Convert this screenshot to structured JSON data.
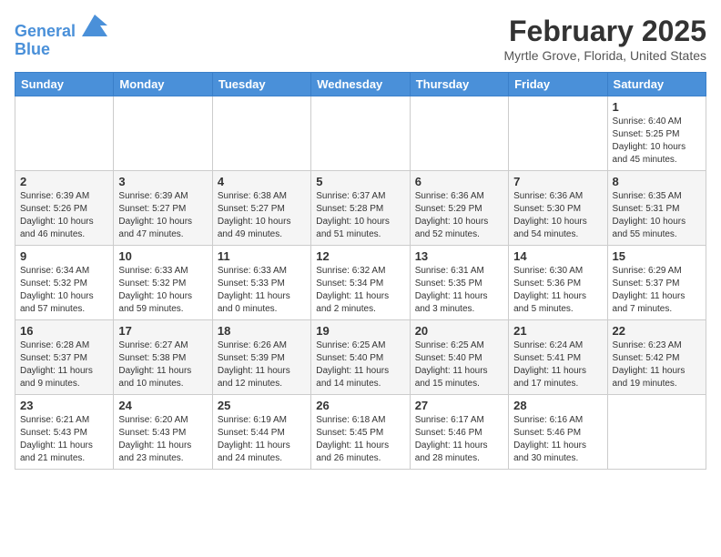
{
  "header": {
    "logo_line1": "General",
    "logo_line2": "Blue",
    "month_title": "February 2025",
    "location": "Myrtle Grove, Florida, United States"
  },
  "weekdays": [
    "Sunday",
    "Monday",
    "Tuesday",
    "Wednesday",
    "Thursday",
    "Friday",
    "Saturday"
  ],
  "weeks": [
    [
      {
        "day": "",
        "info": ""
      },
      {
        "day": "",
        "info": ""
      },
      {
        "day": "",
        "info": ""
      },
      {
        "day": "",
        "info": ""
      },
      {
        "day": "",
        "info": ""
      },
      {
        "day": "",
        "info": ""
      },
      {
        "day": "1",
        "info": "Sunrise: 6:40 AM\nSunset: 5:25 PM\nDaylight: 10 hours and 45 minutes."
      }
    ],
    [
      {
        "day": "2",
        "info": "Sunrise: 6:39 AM\nSunset: 5:26 PM\nDaylight: 10 hours and 46 minutes."
      },
      {
        "day": "3",
        "info": "Sunrise: 6:39 AM\nSunset: 5:27 PM\nDaylight: 10 hours and 47 minutes."
      },
      {
        "day": "4",
        "info": "Sunrise: 6:38 AM\nSunset: 5:27 PM\nDaylight: 10 hours and 49 minutes."
      },
      {
        "day": "5",
        "info": "Sunrise: 6:37 AM\nSunset: 5:28 PM\nDaylight: 10 hours and 51 minutes."
      },
      {
        "day": "6",
        "info": "Sunrise: 6:36 AM\nSunset: 5:29 PM\nDaylight: 10 hours and 52 minutes."
      },
      {
        "day": "7",
        "info": "Sunrise: 6:36 AM\nSunset: 5:30 PM\nDaylight: 10 hours and 54 minutes."
      },
      {
        "day": "8",
        "info": "Sunrise: 6:35 AM\nSunset: 5:31 PM\nDaylight: 10 hours and 55 minutes."
      }
    ],
    [
      {
        "day": "9",
        "info": "Sunrise: 6:34 AM\nSunset: 5:32 PM\nDaylight: 10 hours and 57 minutes."
      },
      {
        "day": "10",
        "info": "Sunrise: 6:33 AM\nSunset: 5:32 PM\nDaylight: 10 hours and 59 minutes."
      },
      {
        "day": "11",
        "info": "Sunrise: 6:33 AM\nSunset: 5:33 PM\nDaylight: 11 hours and 0 minutes."
      },
      {
        "day": "12",
        "info": "Sunrise: 6:32 AM\nSunset: 5:34 PM\nDaylight: 11 hours and 2 minutes."
      },
      {
        "day": "13",
        "info": "Sunrise: 6:31 AM\nSunset: 5:35 PM\nDaylight: 11 hours and 3 minutes."
      },
      {
        "day": "14",
        "info": "Sunrise: 6:30 AM\nSunset: 5:36 PM\nDaylight: 11 hours and 5 minutes."
      },
      {
        "day": "15",
        "info": "Sunrise: 6:29 AM\nSunset: 5:37 PM\nDaylight: 11 hours and 7 minutes."
      }
    ],
    [
      {
        "day": "16",
        "info": "Sunrise: 6:28 AM\nSunset: 5:37 PM\nDaylight: 11 hours and 9 minutes."
      },
      {
        "day": "17",
        "info": "Sunrise: 6:27 AM\nSunset: 5:38 PM\nDaylight: 11 hours and 10 minutes."
      },
      {
        "day": "18",
        "info": "Sunrise: 6:26 AM\nSunset: 5:39 PM\nDaylight: 11 hours and 12 minutes."
      },
      {
        "day": "19",
        "info": "Sunrise: 6:25 AM\nSunset: 5:40 PM\nDaylight: 11 hours and 14 minutes."
      },
      {
        "day": "20",
        "info": "Sunrise: 6:25 AM\nSunset: 5:40 PM\nDaylight: 11 hours and 15 minutes."
      },
      {
        "day": "21",
        "info": "Sunrise: 6:24 AM\nSunset: 5:41 PM\nDaylight: 11 hours and 17 minutes."
      },
      {
        "day": "22",
        "info": "Sunrise: 6:23 AM\nSunset: 5:42 PM\nDaylight: 11 hours and 19 minutes."
      }
    ],
    [
      {
        "day": "23",
        "info": "Sunrise: 6:21 AM\nSunset: 5:43 PM\nDaylight: 11 hours and 21 minutes."
      },
      {
        "day": "24",
        "info": "Sunrise: 6:20 AM\nSunset: 5:43 PM\nDaylight: 11 hours and 23 minutes."
      },
      {
        "day": "25",
        "info": "Sunrise: 6:19 AM\nSunset: 5:44 PM\nDaylight: 11 hours and 24 minutes."
      },
      {
        "day": "26",
        "info": "Sunrise: 6:18 AM\nSunset: 5:45 PM\nDaylight: 11 hours and 26 minutes."
      },
      {
        "day": "27",
        "info": "Sunrise: 6:17 AM\nSunset: 5:46 PM\nDaylight: 11 hours and 28 minutes."
      },
      {
        "day": "28",
        "info": "Sunrise: 6:16 AM\nSunset: 5:46 PM\nDaylight: 11 hours and 30 minutes."
      },
      {
        "day": "",
        "info": ""
      }
    ]
  ]
}
